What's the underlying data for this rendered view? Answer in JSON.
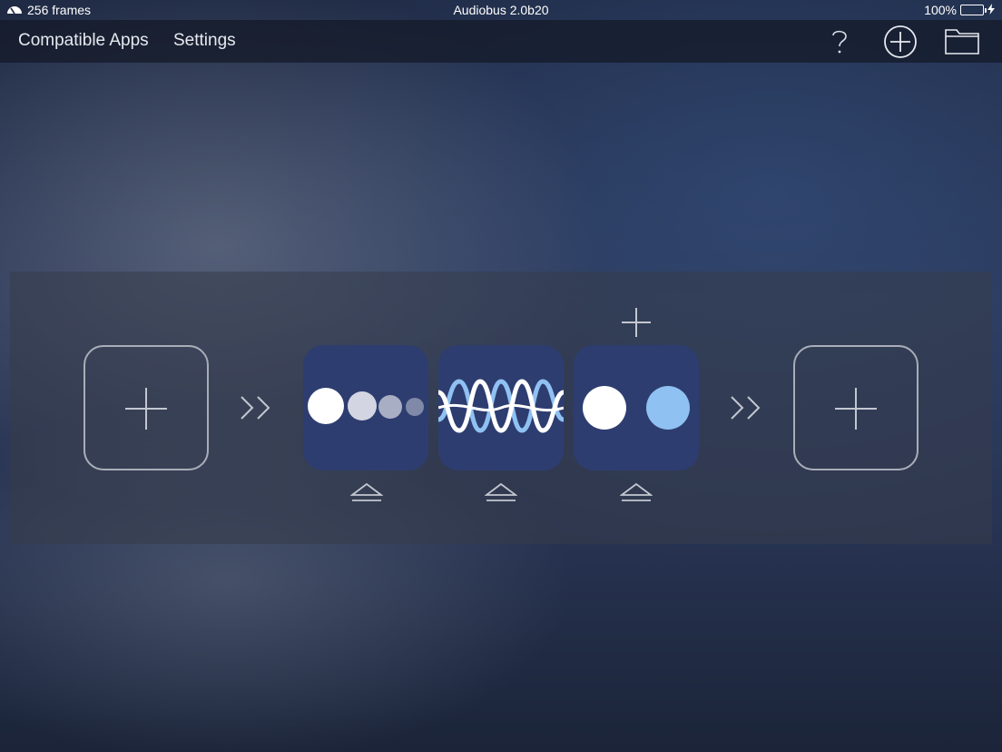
{
  "status_bar": {
    "frames": "256 frames",
    "title": "Audiobus 2.0b20",
    "battery": "100%",
    "icons": [
      "latency-gauge-icon",
      "battery-icon",
      "charging-bolt-icon"
    ]
  },
  "navbar": {
    "compatible_apps": "Compatible Apps",
    "settings": "Settings",
    "icons": [
      "help-icon",
      "add-circle-icon",
      "folder-icon"
    ]
  },
  "pipeline": {
    "input_slot": {
      "icon": "plus-icon"
    },
    "apps": [
      {
        "icon": "dots-decreasing-app-icon"
      },
      {
        "icon": "sine-waves-app-icon"
      },
      {
        "icon": "two-dots-app-icon"
      }
    ],
    "output_slot": {
      "icon": "plus-icon"
    },
    "connectors": [
      "double-chevron-right-icon",
      "double-chevron-right-icon"
    ],
    "add_effect": {
      "icon": "plus-icon"
    },
    "eject": {
      "icon": "eject-icon"
    }
  },
  "colors": {
    "tile": "#2e3d70",
    "accent_light_blue": "#8fc1f2",
    "outline": "#a9adb8"
  }
}
